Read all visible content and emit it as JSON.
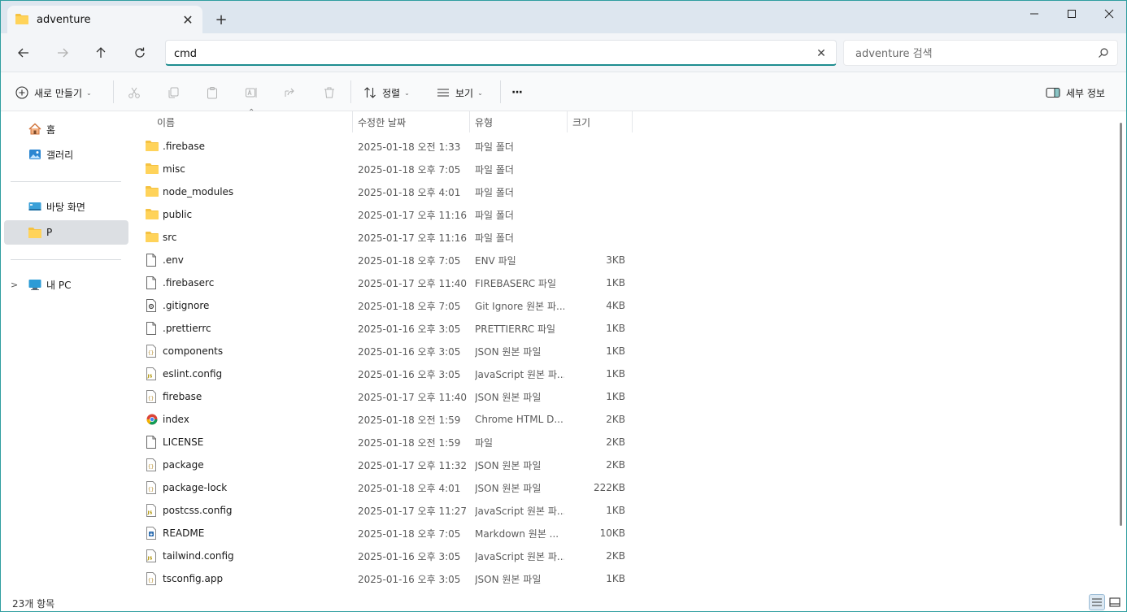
{
  "tab": {
    "title": "adventure",
    "close_glyph": "✕",
    "new_tab_glyph": "+"
  },
  "window_controls": {
    "minimize": "—",
    "maximize": "☐",
    "close": "✕"
  },
  "address": {
    "value": "cmd",
    "clear_glyph": "✕"
  },
  "search": {
    "placeholder": "adventure 검색"
  },
  "toolbar": {
    "new_label": "새로 만들기",
    "sort_label": "정렬",
    "view_label": "보기",
    "more_label": "···",
    "details_label": "세부 정보"
  },
  "sidebar": {
    "home": "홈",
    "gallery": "갤러리",
    "desktop": "바탕 화면",
    "p_folder": "P",
    "this_pc": "내 PC"
  },
  "columns": {
    "name": "이름",
    "date": "수정한 날짜",
    "type": "유형",
    "size": "크기"
  },
  "files": [
    {
      "name": ".firebase",
      "date": "2025-01-18 오전 1:33",
      "type": "파일 폴더",
      "size": "",
      "icon": "folder-icon"
    },
    {
      "name": "misc",
      "date": "2025-01-18 오후 7:05",
      "type": "파일 폴더",
      "size": "",
      "icon": "folder-icon"
    },
    {
      "name": "node_modules",
      "date": "2025-01-18 오후 4:01",
      "type": "파일 폴더",
      "size": "",
      "icon": "folder-icon"
    },
    {
      "name": "public",
      "date": "2025-01-17 오후 11:16",
      "type": "파일 폴더",
      "size": "",
      "icon": "folder-icon"
    },
    {
      "name": "src",
      "date": "2025-01-17 오후 11:16",
      "type": "파일 폴더",
      "size": "",
      "icon": "folder-icon"
    },
    {
      "name": ".env",
      "date": "2025-01-18 오후 7:05",
      "type": "ENV 파일",
      "size": "3KB",
      "icon": "file-icon"
    },
    {
      "name": ".firebaserc",
      "date": "2025-01-17 오후 11:40",
      "type": "FIREBASERC 파일",
      "size": "1KB",
      "icon": "file-icon"
    },
    {
      "name": ".gitignore",
      "date": "2025-01-18 오후 7:05",
      "type": "Git Ignore 원본 파...",
      "size": "4KB",
      "icon": "gear-file-icon"
    },
    {
      "name": ".prettierrc",
      "date": "2025-01-16 오후 3:05",
      "type": "PRETTIERRC 파일",
      "size": "1KB",
      "icon": "file-icon"
    },
    {
      "name": "components",
      "date": "2025-01-16 오후 3:05",
      "type": "JSON 원본 파일",
      "size": "1KB",
      "icon": "json-file-icon"
    },
    {
      "name": "eslint.config",
      "date": "2025-01-16 오후 3:05",
      "type": "JavaScript 원본 파...",
      "size": "1KB",
      "icon": "js-file-icon"
    },
    {
      "name": "firebase",
      "date": "2025-01-17 오후 11:40",
      "type": "JSON 원본 파일",
      "size": "1KB",
      "icon": "json-file-icon"
    },
    {
      "name": "index",
      "date": "2025-01-18 오전 1:59",
      "type": "Chrome HTML D...",
      "size": "2KB",
      "icon": "chrome-icon"
    },
    {
      "name": "LICENSE",
      "date": "2025-01-18 오전 1:59",
      "type": "파일",
      "size": "2KB",
      "icon": "file-icon"
    },
    {
      "name": "package",
      "date": "2025-01-17 오후 11:32",
      "type": "JSON 원본 파일",
      "size": "2KB",
      "icon": "json-file-icon"
    },
    {
      "name": "package-lock",
      "date": "2025-01-18 오후 4:01",
      "type": "JSON 원본 파일",
      "size": "222KB",
      "icon": "json-file-icon"
    },
    {
      "name": "postcss.config",
      "date": "2025-01-17 오후 11:27",
      "type": "JavaScript 원본 파...",
      "size": "1KB",
      "icon": "js-file-icon"
    },
    {
      "name": "README",
      "date": "2025-01-18 오후 7:05",
      "type": "Markdown 원본 ...",
      "size": "10KB",
      "icon": "markdown-file-icon"
    },
    {
      "name": "tailwind.config",
      "date": "2025-01-16 오후 3:05",
      "type": "JavaScript 원본 파...",
      "size": "2KB",
      "icon": "js-file-icon"
    },
    {
      "name": "tsconfig.app",
      "date": "2025-01-16 오후 3:05",
      "type": "JSON 원본 파일",
      "size": "1KB",
      "icon": "json-file-icon"
    }
  ],
  "status": {
    "item_count": "23개 항목"
  },
  "colors": {
    "accent": "#1e8d8f",
    "folder": "#f5c242",
    "titlebar": "#dde6ef"
  }
}
